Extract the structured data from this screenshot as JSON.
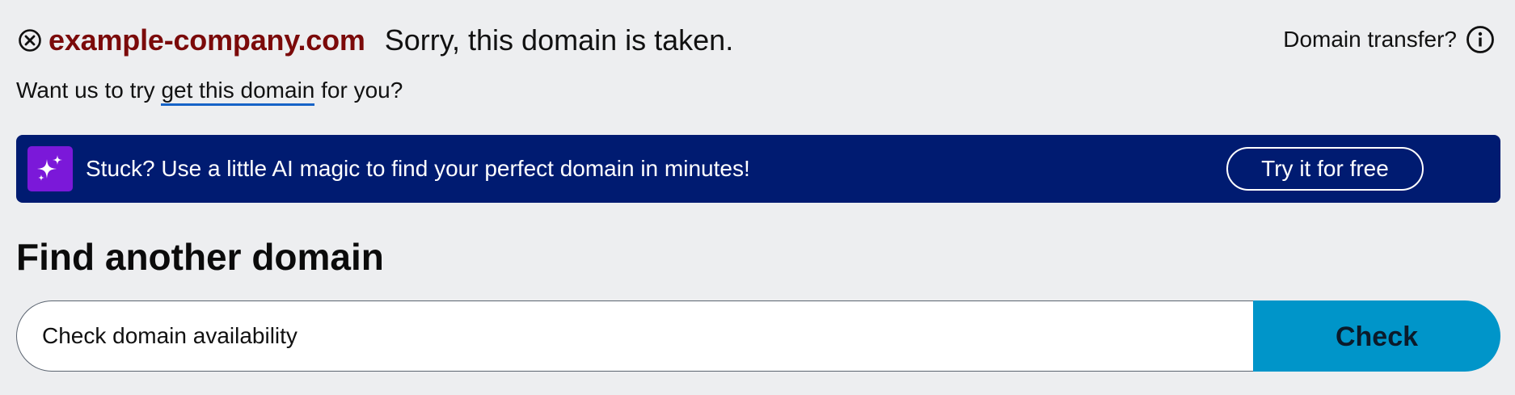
{
  "status": {
    "domain": "example-company.com",
    "message": "Sorry, this domain is taken.",
    "icon": "circle-x-icon",
    "domain_color": "#7b0a0a"
  },
  "transfer": {
    "label": "Domain transfer?",
    "icon": "info-icon"
  },
  "help": {
    "prefix": "Want us to try",
    "link": "get this domain",
    "suffix": "for you?"
  },
  "promo": {
    "text": "Stuck? Use a little AI magic to find your perfect domain in minutes!",
    "button": "Try it for free",
    "icon": "sparkles-icon",
    "background": "#001b71",
    "icon_background": "#7b18d9"
  },
  "search": {
    "title": "Find another domain",
    "placeholder": "Check domain availability",
    "button": "Check",
    "button_color": "#0095c9"
  }
}
